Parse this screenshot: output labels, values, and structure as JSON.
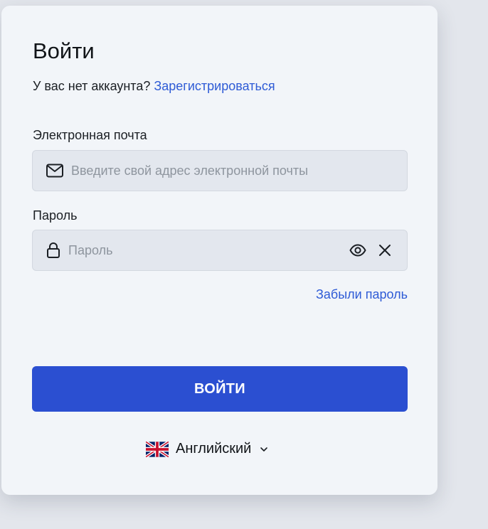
{
  "login": {
    "title": "Войти",
    "no_account_text": "У вас нет аккаунта?",
    "signup_link": "Зарегистрироваться",
    "email": {
      "label": "Электронная почта",
      "placeholder": "Введите свой адрес электронной почты",
      "value": "",
      "icon": "mail-icon"
    },
    "password": {
      "label": "Пароль",
      "placeholder": "Пароль",
      "value": "",
      "icon": "lock-icon",
      "show_icon": "eye-icon",
      "clear_icon": "close-icon"
    },
    "forgot_link": "Забыли пароль",
    "submit_label": "ВОЙТИ",
    "language": {
      "selected": "Английский",
      "flag_icon": "uk-flag-icon",
      "chevron_icon": "chevron-down-icon"
    }
  },
  "colors": {
    "accent": "#2b4fd1",
    "link": "#2e5bd6",
    "card_bg": "#f2f5f9",
    "field_bg": "#e3e7ee",
    "page_bg": "#e3e6ec"
  }
}
